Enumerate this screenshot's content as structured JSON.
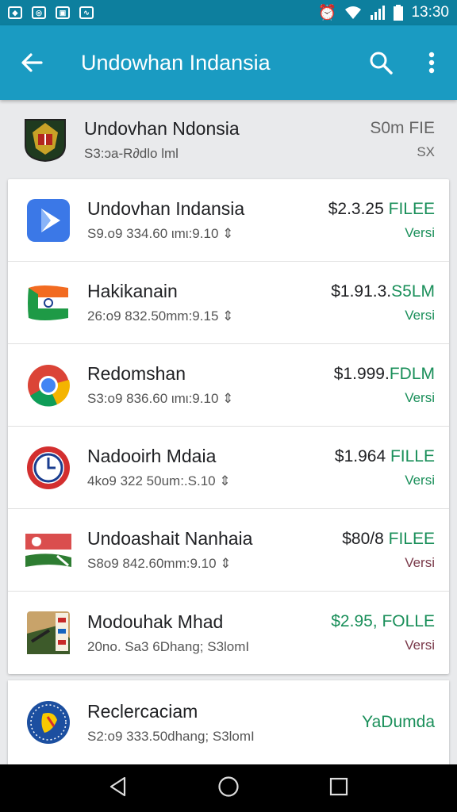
{
  "status_bar": {
    "left_icons": [
      "notification-icon-1",
      "notification-icon-2",
      "notification-icon-3",
      "notification-icon-4"
    ],
    "time": "13:30"
  },
  "app_bar": {
    "title": "Undowhan Indansia",
    "color": "#1a9bc2"
  },
  "header": {
    "name": "Undovhan Ndonsia",
    "sub": "S3:ɔa-R∂dlo lml",
    "right_top": "S0m FIE",
    "right_bottom": "SX"
  },
  "apps": [
    {
      "name": "Undovhan Indansia",
      "sub": "S9.o9 334.60 ιmι:9.10 ⇕",
      "price": "$2.3.25",
      "price_hl": " FILEE",
      "ver": "Versi",
      "ver_style": "green"
    },
    {
      "name": "Hakikanain",
      "sub": "26:o9 832.50mm:9.15 ⇕",
      "price": "$1.91.3.",
      "price_hl": "S5LM",
      "ver": "Versi",
      "ver_style": "green"
    },
    {
      "name": "Redomshan",
      "sub": "S3:o9 836.60 ιmι:9.10 ⇕",
      "price": "$1.999.",
      "price_hl": "FDLM",
      "ver": "Versi",
      "ver_style": "green"
    },
    {
      "name": "Nadooirh Mdaia",
      "sub": "4ko9 322 50um:.S.10 ⇕",
      "price": "$1.964",
      "price_hl": " FILLE",
      "ver": "Versi",
      "ver_style": "green"
    },
    {
      "name": "Undoashait Nanhaia",
      "sub": "S8o9 842.60mm:9.10 ⇕",
      "price": "$80/8",
      "price_hl": " FILEE",
      "ver": "Versi",
      "ver_style": "maroon"
    },
    {
      "name": "Modouhak Mhad",
      "sub": "20no. Sa3 6Dhang; S3lomI",
      "price": "",
      "price_hl": "$2.95, FOLLE",
      "ver": "Versi",
      "ver_style": "maroon"
    }
  ],
  "last_app": {
    "name": "Reclercaciam",
    "sub": "S2:o9 333.50dhang; S3lomI",
    "right": "YaDumda"
  },
  "nav": {
    "back": "back-icon",
    "home": "home-icon",
    "recents": "recents-icon"
  }
}
